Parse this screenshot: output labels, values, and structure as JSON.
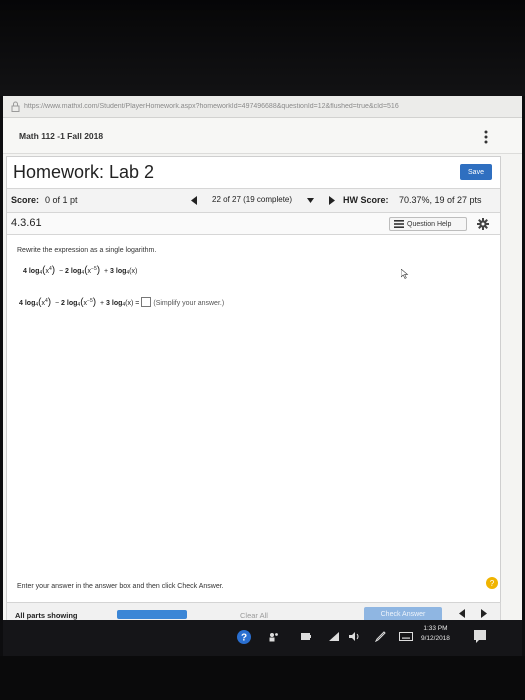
{
  "browser": {
    "url": "https://www.mathxl.com/Student/PlayerHomework.aspx?homeworkId=497496688&questionId=12&flushed=true&cId=516"
  },
  "course": {
    "title": "Math 112 -1 Fall 2018"
  },
  "homework": {
    "title": "Homework: Lab 2",
    "save_label": "Save"
  },
  "scorebar": {
    "score_label": "Score:",
    "score_value": "0 of 1 pt",
    "question_selector": "22 of 27 (19 complete)",
    "hw_score_label": "HW Score:",
    "hw_score_value": "70.37%, 19 of 27 pts"
  },
  "question": {
    "number": "4.3.61",
    "help_label": "Question Help",
    "prompt": "Rewrite the expression as a single logarithm.",
    "simplify_hint": "(Simplify your answer.)",
    "expression": {
      "c1": "4",
      "c2": "2",
      "c3": "3",
      "log": "log",
      "base": "4",
      "exp1": "4",
      "exp2": "−5",
      "x": "x",
      "minus": "−",
      "plus": "+",
      "equals": "="
    }
  },
  "footer": {
    "instruction": "Enter your answer in the answer box and then click Check Answer.",
    "parts_label": "All parts showing",
    "progress": 1.0,
    "clear_label": "Clear All",
    "check_label": "Check Answer"
  },
  "taskbar": {
    "time": "1:33 PM",
    "date": "9/12/2018"
  },
  "colors": {
    "accent": "#2f6fc0",
    "progress": "#3b86d6",
    "check_disabled": "#8fb6e2"
  }
}
